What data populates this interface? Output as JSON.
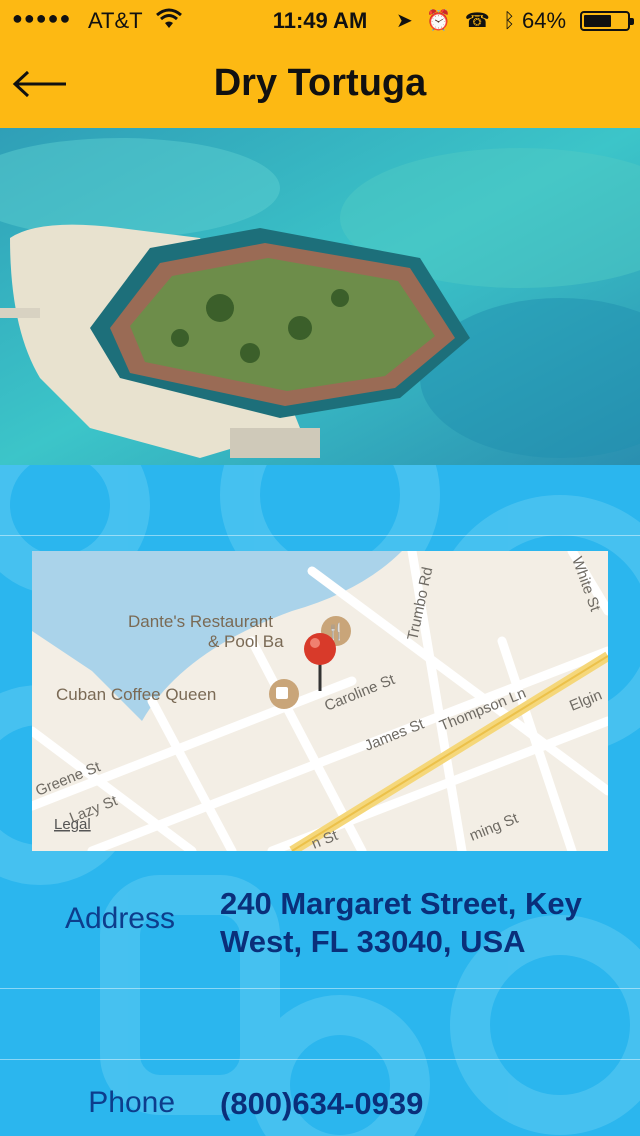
{
  "status_bar": {
    "signal": "●●●●●",
    "carrier": "AT&T",
    "time": "11:49 AM",
    "battery_percent": "64%",
    "battery_level": 0.64,
    "icons": [
      "wifi-icon",
      "location-arrow-icon",
      "alarm-icon",
      "tty-icon",
      "bluetooth-icon",
      "battery-icon"
    ]
  },
  "nav": {
    "back_icon": "back-arrow-icon",
    "title": "Dry Tortuga"
  },
  "map": {
    "pois": [
      {
        "name": "Dante's Restaurant",
        "name2": "& Pool Ba",
        "icon": "restaurant-icon"
      },
      {
        "name": "Cuban Coffee Queen",
        "icon": "coffee-icon"
      }
    ],
    "streets": [
      "Caroline St",
      "James St",
      "Thompson Ln",
      "Trumbo Rd",
      "Greene St",
      "Lazy St",
      "White St",
      "Elgin",
      "n St",
      "ming St"
    ],
    "legal": "Legal",
    "pin_icon": "map-pin-icon"
  },
  "details": {
    "address_label": "Address",
    "address_line1": "240 Margaret Street, Key",
    "address_line2": "West, FL 33040, USA",
    "phone_label": "Phone",
    "phone_value": "(800)634-0939"
  },
  "colors": {
    "header": "#fdb913",
    "panel": "#2bb6ee",
    "text_dark_blue": "#0a2f7a"
  }
}
